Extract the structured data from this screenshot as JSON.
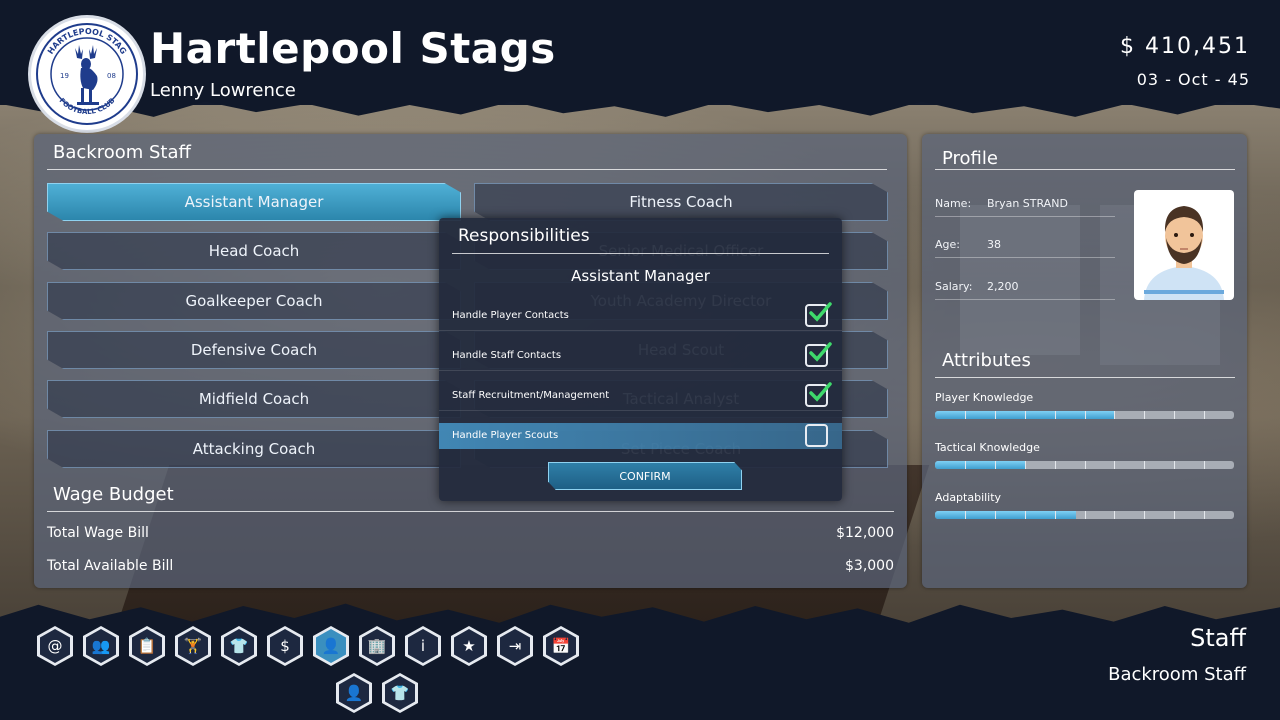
{
  "header": {
    "crest": {
      "top_text": "HARTLEPOOL STAG",
      "bottom_text": "FOOTBALL CLUB",
      "year_left": "19",
      "year_right": "08"
    },
    "club_name": "Hartlepool Stags",
    "manager_name": "Lenny Lowrence",
    "money": "$ 410,451",
    "date": "03 - Oct - 45"
  },
  "backroom": {
    "title": "Backroom Staff",
    "roles_left": [
      "Assistant Manager",
      "Head Coach",
      "Goalkeeper Coach",
      "Defensive Coach",
      "Midfield Coach",
      "Attacking Coach"
    ],
    "roles_right": [
      "Fitness Coach",
      "Senior Medical Officer",
      "Youth Academy Director",
      "Head Scout",
      "Tactical Analyst",
      "Set Piece Coach"
    ],
    "active_role": "Assistant Manager"
  },
  "wage_budget": {
    "title": "Wage Budget",
    "rows": [
      {
        "label": "Total Wage Bill",
        "value": "$12,000"
      },
      {
        "label": "Total Available Bill",
        "value": "$3,000"
      }
    ]
  },
  "profile": {
    "title": "Profile",
    "fields": [
      {
        "label": "Name:",
        "value": "Bryan STRAND"
      },
      {
        "label": "Age:",
        "value": "38"
      },
      {
        "label": "Salary:",
        "value": "2,200"
      }
    ]
  },
  "attributes": {
    "title": "Attributes",
    "items": [
      {
        "label": "Player Knowledge",
        "level": 0.6
      },
      {
        "label": "Tactical Knowledge",
        "level": 0.3
      },
      {
        "label": "Adaptability",
        "level": 0.47
      }
    ]
  },
  "modal": {
    "title": "Responsibilities",
    "subtitle": "Assistant Manager",
    "items": [
      {
        "label": "Handle Player Contacts",
        "checked": true
      },
      {
        "label": "Handle Staff Contacts",
        "checked": true
      },
      {
        "label": "Staff Recruitment/Management",
        "checked": true
      },
      {
        "label": "Handle Player Scouts",
        "checked": false
      }
    ],
    "confirm_label": "CONFIRM",
    "check_color": "#3ed96b"
  },
  "nav": {
    "icons": [
      "at-icon",
      "people-icon",
      "tactics-board-icon",
      "training-dumbbell-icon",
      "kit-transfer-icon",
      "finance-dollar-icon",
      "staff-badge-icon",
      "buildings-icon",
      "info-icon",
      "star-icon",
      "transfer-in-icon",
      "calendar-icon",
      "staff-profile-icon",
      "team-shirt-icon"
    ],
    "glyphs": [
      "@",
      "👥",
      "📋",
      "🏋",
      "👕",
      "$",
      "👤",
      "🏢",
      "i",
      "★",
      "⇥",
      "📅",
      "👤",
      "👕"
    ],
    "active_index": 6
  },
  "footer": {
    "page_title": "Staff",
    "page_subtitle": "Backroom Staff"
  },
  "colors": {
    "accent": "#3a8fbf",
    "active_button": "#4fb0d6",
    "panel": "#5a6478"
  }
}
